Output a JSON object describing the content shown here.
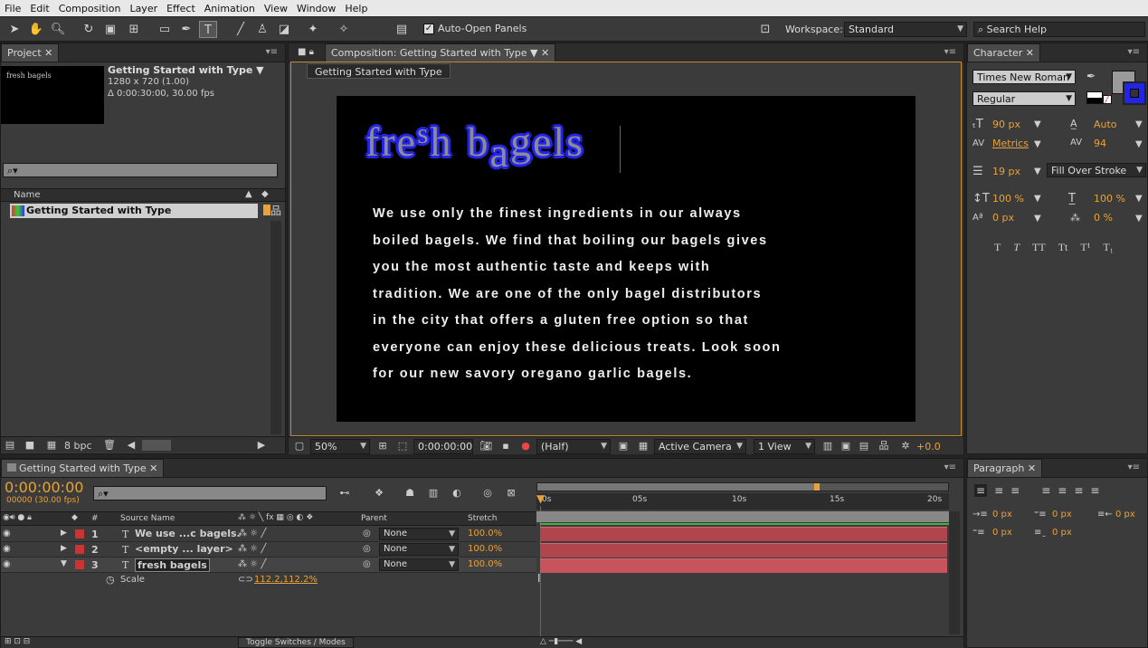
{
  "menu": [
    "File",
    "Edit",
    "Composition",
    "Layer",
    "Effect",
    "Animation",
    "View",
    "Window",
    "Help"
  ],
  "toolbar": {
    "auto_open_panels": "Auto-Open Panels",
    "workspace_label": "Workspace:",
    "workspace_value": "Standard",
    "search_placeholder": "Search Help"
  },
  "project": {
    "tab": "Project",
    "thumb_text": "fresh bagels",
    "comp_name": "Getting Started with Type",
    "comp_size": "1280 x 720 (1.00)",
    "comp_duration": "Δ 0:00:30:00, 30.00 fps",
    "col_name": "Name",
    "item": "Getting Started with Type",
    "bpc": "8 bpc"
  },
  "composition": {
    "tab": "Composition: Getting Started with Type",
    "subtab": "Getting Started with Type",
    "title_letters": [
      "f",
      "r",
      "e",
      "s",
      "h",
      " ",
      "b",
      "a",
      "g",
      "e",
      "l",
      "s"
    ],
    "body_lines": [
      "We use only the finest ingredients in our always",
      "boiled bagels. We find that boiling our bagels gives",
      "you the most authentic taste and keeps with",
      "tradition. We are one of the only bagel distributors",
      "in the city that offers a gluten free option so that",
      "everyone can enjoy these delicious treats. Look soon",
      "for our new savory oregano garlic bagels."
    ],
    "zoom": "50%",
    "timecode": "0:00:00:00",
    "resolution": "(Half)",
    "camera": "Active Camera",
    "views": "1 View",
    "exposure": "+0.0"
  },
  "character": {
    "tab": "Character",
    "font": "Times New Roman",
    "style": "Regular",
    "size": "90 px",
    "leading": "Auto",
    "kerning": "Metrics",
    "tracking": "94",
    "stroke_width": "19 px",
    "stroke_mode": "Fill Over Stroke",
    "vscale": "100 %",
    "hscale": "100 %",
    "baseline": "0 px",
    "tsume": "0 %",
    "fill_color": "#2424e6",
    "stroke_color": "#9a9a9a",
    "styles": [
      "T",
      "T",
      "TT",
      "Tt",
      "T¹",
      "T₁"
    ]
  },
  "paragraph": {
    "tab": "Paragraph",
    "indent_left": "0 px",
    "indent_first": "0 px",
    "indent_right": "0 px",
    "space_before": "0 px",
    "space_after": "0 px"
  },
  "timeline": {
    "tab": "Getting Started with Type",
    "timecode": "0:00:00:00",
    "fps": "00000 (30.00 fps)",
    "headers": {
      "num": "#",
      "source": "Source Name",
      "parent": "Parent",
      "stretch": "Stretch"
    },
    "ruler": [
      "0s",
      "05s",
      "10s",
      "15s",
      "20s"
    ],
    "layers": [
      {
        "num": "1",
        "name": "We use ...c bagels.",
        "parent": "None",
        "stretch": "100.0%"
      },
      {
        "num": "2",
        "name": "<empty ... layer>",
        "parent": "None",
        "stretch": "100.0%"
      },
      {
        "num": "3",
        "name": "fresh bagels",
        "parent": "None",
        "stretch": "100.0%"
      }
    ],
    "scale_label": "Scale",
    "scale_value": "112.2,112.2%",
    "toggle": "Toggle Switches / Modes"
  }
}
